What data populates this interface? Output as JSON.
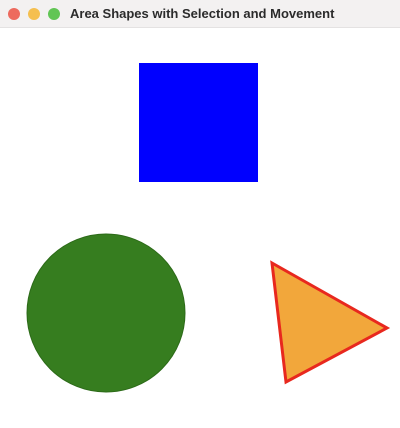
{
  "window": {
    "title": "Area Shapes with Selection and Movement",
    "controls": [
      {
        "name": "close",
        "color": "#ed6a5e"
      },
      {
        "name": "minimize",
        "color": "#f5bf4f"
      },
      {
        "name": "zoom",
        "color": "#61c554"
      }
    ]
  },
  "shapes": {
    "square": {
      "fill": "#0000ff"
    },
    "circle": {
      "fill": "#367d1f",
      "stroke": "#2c6a18"
    },
    "triangle": {
      "fill": "#f2a73b",
      "stroke": "#e8281e",
      "selected": true
    }
  }
}
